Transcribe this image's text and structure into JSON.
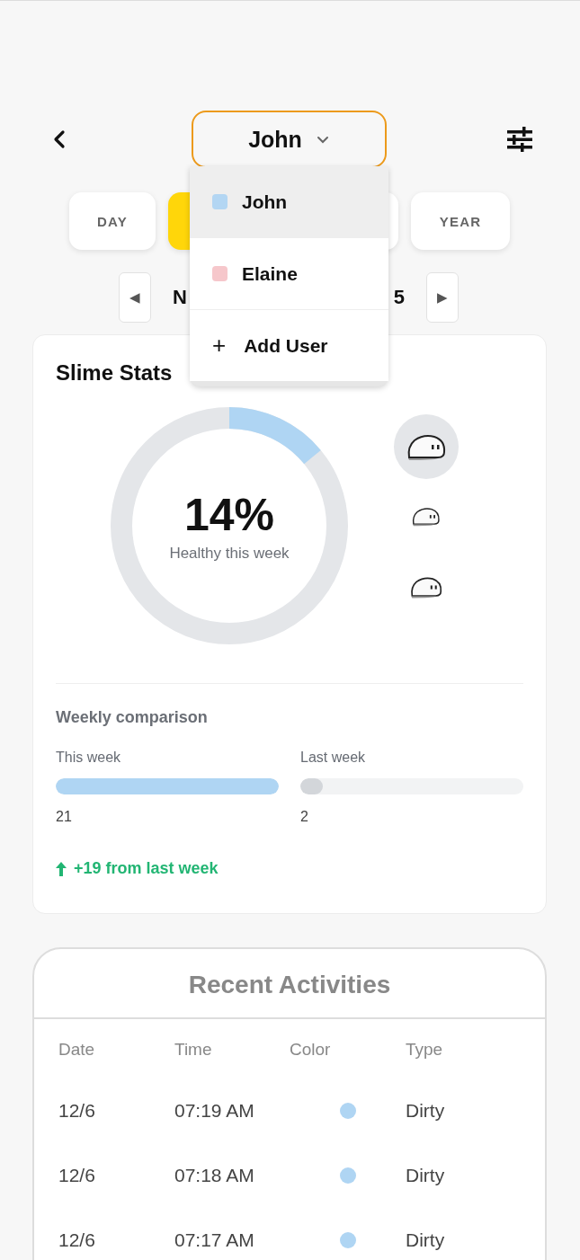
{
  "header": {
    "user": "John"
  },
  "user_menu": {
    "items": [
      {
        "kind": "user",
        "label": "John",
        "color": "#b3d6f3",
        "selected": true
      },
      {
        "kind": "user",
        "label": "Elaine",
        "color": "#f6c7cb",
        "selected": false
      },
      {
        "kind": "add",
        "icon": "+",
        "label": "Add User",
        "selected": false
      }
    ]
  },
  "period_tabs": [
    {
      "label": "DAY",
      "selected": false
    },
    {
      "selected": true
    },
    {
      "selected": false
    },
    {
      "label": "YEAR",
      "selected": false
    }
  ],
  "date_nav": {
    "prev": "◀",
    "label_start": "N",
    "label_end": "5",
    "next": "▶"
  },
  "slime_stats": {
    "title": "Slime Stats",
    "percent": "14%",
    "caption": "Healthy this week",
    "level": 0.14,
    "slimes": [
      {
        "selected": true
      },
      {
        "selected": false
      },
      {
        "selected": false
      }
    ],
    "comparison": {
      "title": "Weekly comparison",
      "bars": [
        {
          "label": "This week",
          "value": "21",
          "level": 1.0,
          "color": "#afd5f3"
        },
        {
          "label": "Last week",
          "value": "2",
          "level": 0.1,
          "color": "#d3d6da"
        }
      ],
      "change": "+19 from last week"
    }
  },
  "recent_activities": {
    "title": "Recent Activities",
    "columns": [
      "Date",
      "Time",
      "Color",
      "Type"
    ],
    "rows": [
      {
        "date": "12/6",
        "time": "07:19 AM",
        "color": "#afd5f3",
        "type": "Dirty"
      },
      {
        "date": "12/6",
        "time": "07:18 AM",
        "color": "#afd5f3",
        "type": "Dirty"
      },
      {
        "date": "12/6",
        "time": "07:17 AM",
        "color": "#afd5f3",
        "type": "Dirty"
      }
    ]
  }
}
